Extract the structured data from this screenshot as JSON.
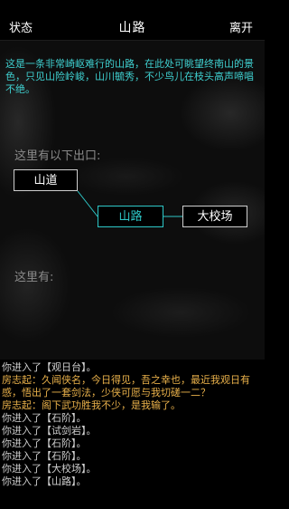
{
  "header": {
    "status_label": "状态",
    "title": "山路",
    "leave_label": "离开"
  },
  "room": {
    "description": "这是一条非常崎岖难行的山路，在此处可眺望终南山的景色，只见山险岭峻，山川毓秀，不少鸟儿在枝头高声啼唱不绝。",
    "exits_label": "这里有以下出口:",
    "here_label": "这里有:"
  },
  "map": {
    "west": "山道",
    "current": "山路",
    "east": "大校场"
  },
  "log": [
    {
      "text": "你进入了【观日台】。",
      "type": "system"
    },
    {
      "text": "房志起：久闻侠名，今日得见，吾之幸也，最近我观日有感，悟出了一套剑法，少侠可愿与我切磋一二？",
      "type": "say"
    },
    {
      "text": "房志起：阁下武功胜我不少，是我输了。",
      "type": "say"
    },
    {
      "text": "你进入了【石阶】。",
      "type": "system"
    },
    {
      "text": "你进入了【试剑岩】。",
      "type": "system"
    },
    {
      "text": "你进入了【石阶】。",
      "type": "system"
    },
    {
      "text": "你进入了【石阶】。",
      "type": "system"
    },
    {
      "text": "你进入了【大校场】。",
      "type": "system"
    },
    {
      "text": "你进入了【山路】。",
      "type": "system"
    }
  ],
  "colors": {
    "description": "#3fd0d0",
    "current_room": "#2ec8c8",
    "npc_speech": "#e8b04a",
    "system_text": "#d0d0d0"
  }
}
